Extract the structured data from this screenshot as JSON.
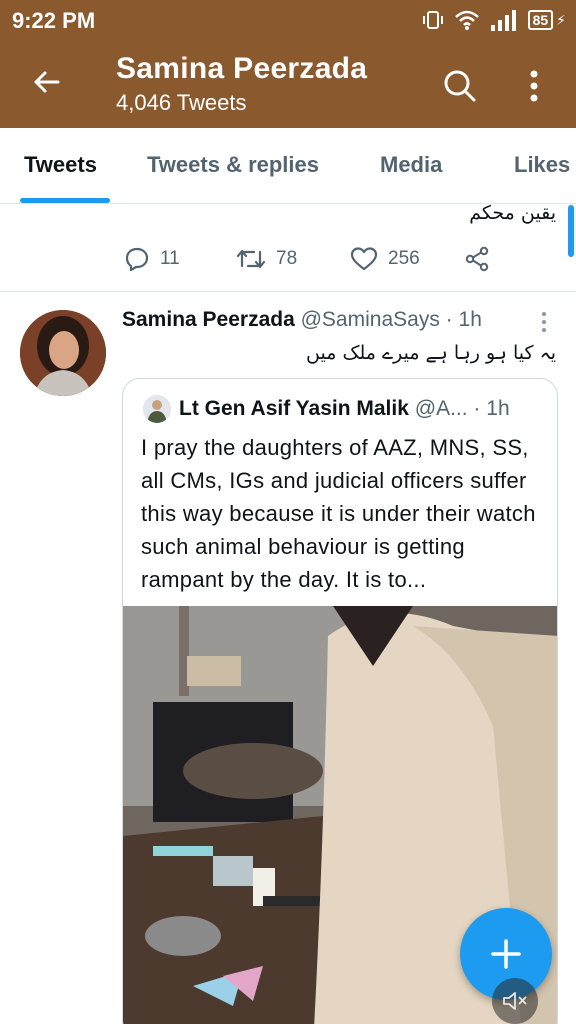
{
  "status_bar": {
    "time": "9:22 PM",
    "battery": "85",
    "icons": [
      "vibrate-icon",
      "wifi-icon",
      "signal-icon",
      "battery-icon",
      "charging-icon"
    ]
  },
  "header": {
    "title": "Samina Peerzada",
    "subtitle": "4,046 Tweets",
    "background": "#8a5a2e"
  },
  "tabs": [
    {
      "label": "Tweets",
      "active": true
    },
    {
      "label": "Tweets & replies",
      "active": false
    },
    {
      "label": "Media",
      "active": false
    },
    {
      "label": "Likes",
      "active": false
    }
  ],
  "accent": "#1d9bf0",
  "previous_tweet": {
    "text": "یقین محکم",
    "replies": "11",
    "retweets": "78",
    "likes": "256"
  },
  "tweet": {
    "author_name": "Samina Peerzada",
    "author_handle": "@SaminaSays",
    "separator": "·",
    "time": "1h",
    "text": "یہ کیا ہو رہا ہے میرے ملک میں",
    "quote": {
      "author_name": "Lt Gen Asif Yasin Malik",
      "author_handle": "@A...",
      "time": "1h",
      "text": "I pray the daughters of AAZ, MNS, SS, all CMs, IGs and judicial officers suffer this way because it is under their watch such animal behaviour is getting rampant by the day. It is to..."
    }
  }
}
